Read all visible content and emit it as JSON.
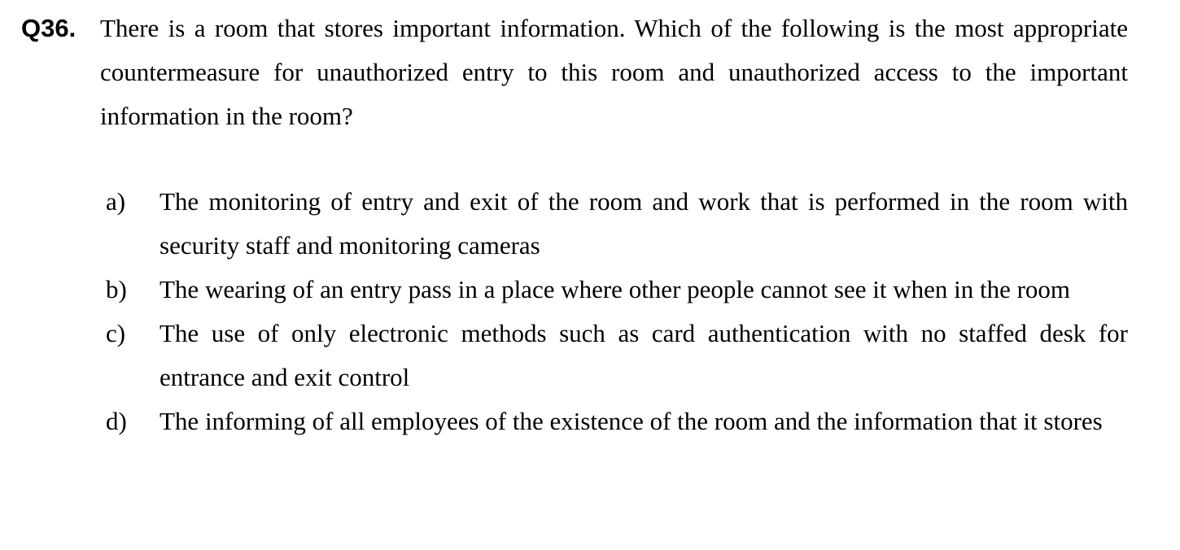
{
  "question": {
    "number": "Q36.",
    "text": "There is a room that stores important information. Which of the following is the most appropriate countermeasure for unauthorized entry to this room and unauthorized access to the important information in the room?"
  },
  "options": [
    {
      "letter": "a)",
      "text": "The monitoring of entry and exit of the room and work that is performed in the room with security staff and monitoring cameras"
    },
    {
      "letter": "b)",
      "text": "The wearing of an entry pass in a place where other people cannot see it when in the room"
    },
    {
      "letter": "c)",
      "text": "The use of only electronic methods such as card authentication with no staffed desk for entrance and exit control"
    },
    {
      "letter": "d)",
      "text": "The informing of all employees of the existence of the room and the information that it stores"
    }
  ]
}
